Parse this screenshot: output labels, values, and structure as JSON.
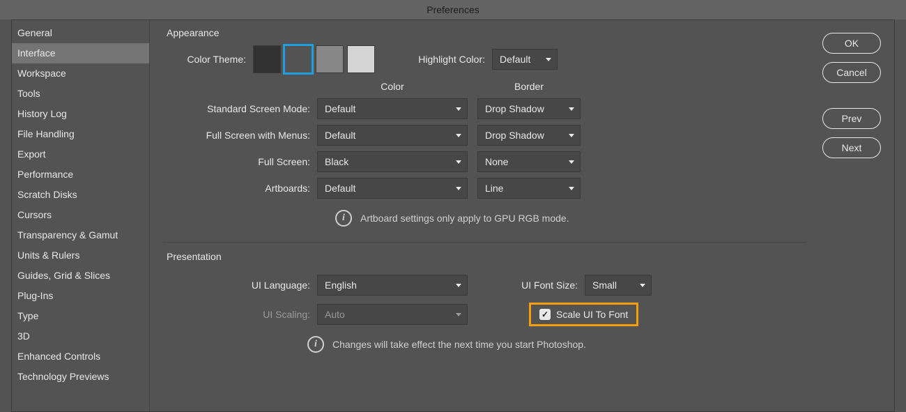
{
  "titlebar": "Preferences",
  "sidebar": {
    "items": [
      "General",
      "Interface",
      "Workspace",
      "Tools",
      "History Log",
      "File Handling",
      "Export",
      "Performance",
      "Scratch Disks",
      "Cursors",
      "Transparency & Gamut",
      "Units & Rulers",
      "Guides, Grid & Slices",
      "Plug-Ins",
      "Type",
      "3D",
      "Enhanced Controls",
      "Technology Previews"
    ],
    "selected_index": 1
  },
  "buttons": {
    "ok": "OK",
    "cancel": "Cancel",
    "prev": "Prev",
    "next": "Next"
  },
  "appearance": {
    "section_title": "Appearance",
    "color_theme_label": "Color Theme:",
    "swatches": [
      "#323232",
      "#535353",
      "#878787",
      "#d4d4d4"
    ],
    "selected_swatch_index": 1,
    "highlight_label": "Highlight Color:",
    "highlight_value": "Default",
    "grid_color_hdr": "Color",
    "grid_border_hdr": "Border",
    "rows": [
      {
        "label": "Standard Screen Mode:",
        "color": "Default",
        "border": "Drop Shadow"
      },
      {
        "label": "Full Screen with Menus:",
        "color": "Default",
        "border": "Drop Shadow"
      },
      {
        "label": "Full Screen:",
        "color": "Black",
        "border": "None"
      },
      {
        "label": "Artboards:",
        "color": "Default",
        "border": "Line"
      }
    ],
    "note": "Artboard settings only apply to GPU RGB mode."
  },
  "presentation": {
    "section_title": "Presentation",
    "ui_language_label": "UI Language:",
    "ui_language_value": "English",
    "ui_scaling_label": "UI Scaling:",
    "ui_scaling_value": "Auto",
    "ui_font_size_label": "UI Font Size:",
    "ui_font_size_value": "Small",
    "scale_ui_label": "Scale UI To Font",
    "scale_ui_checked": true,
    "note": "Changes will take effect the next time you start Photoshop."
  }
}
